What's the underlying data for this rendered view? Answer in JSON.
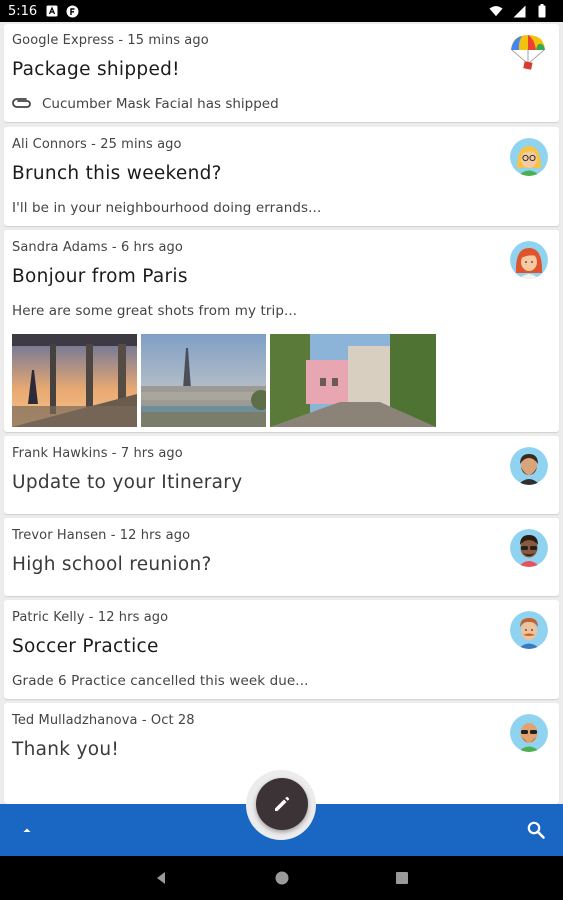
{
  "status_bar": {
    "time": "5:16",
    "icons": [
      "a-icon",
      "f-icon",
      "wifi-icon",
      "signal-icon",
      "battery-icon"
    ]
  },
  "emails": [
    {
      "sender": "Google Express",
      "time": "15 mins ago",
      "subject": "Package shipped!",
      "attachment": "Cucumber Mask Facial has shipped",
      "avatar": "parachute-avatar"
    },
    {
      "sender": "Ali Connors",
      "time": "25 mins ago",
      "subject": "Brunch this weekend?",
      "preview": "I'll be in your neighbourhood doing errands...",
      "avatar": "woman-glasses-avatar"
    },
    {
      "sender": "Sandra Adams",
      "time": "6 hrs ago",
      "subject": "Bonjour from Paris",
      "preview": "Here are some great shots from my trip...",
      "avatar": "red-hair-woman-avatar",
      "photos": [
        "eiffel-bridge-photo",
        "paris-skyline-photo",
        "montmartre-street-photo"
      ]
    },
    {
      "sender": "Frank Hawkins",
      "time": "7 hrs ago",
      "subject": "Update to your Itinerary",
      "avatar": "bearded-man-avatar"
    },
    {
      "sender": "Trevor Hansen",
      "time": "12 hrs ago",
      "subject": "High school reunion?",
      "avatar": "sunglasses-man-avatar"
    },
    {
      "sender": "Patric Kelly",
      "time": "12 hrs ago",
      "subject": "Soccer Practice",
      "preview": "Grade 6 Practice cancelled this week due...",
      "avatar": "mustache-man-avatar"
    },
    {
      "sender": "Ted Mulladzhanova",
      "time": "Oct 28",
      "subject": "Thank you!",
      "avatar": "bald-man-sunglasses-avatar"
    }
  ],
  "separator": " - ",
  "colors": {
    "bottom_bar": "#1a67c3",
    "fab": "#3b3336",
    "background": "#ececec"
  },
  "bottom_bar": {
    "left_icon": "chevron-up-icon",
    "right_icon": "search-icon"
  },
  "fab": {
    "icon": "pencil-icon"
  },
  "nav_bar": {
    "icons": [
      "back-icon",
      "home-icon",
      "recents-icon"
    ]
  }
}
